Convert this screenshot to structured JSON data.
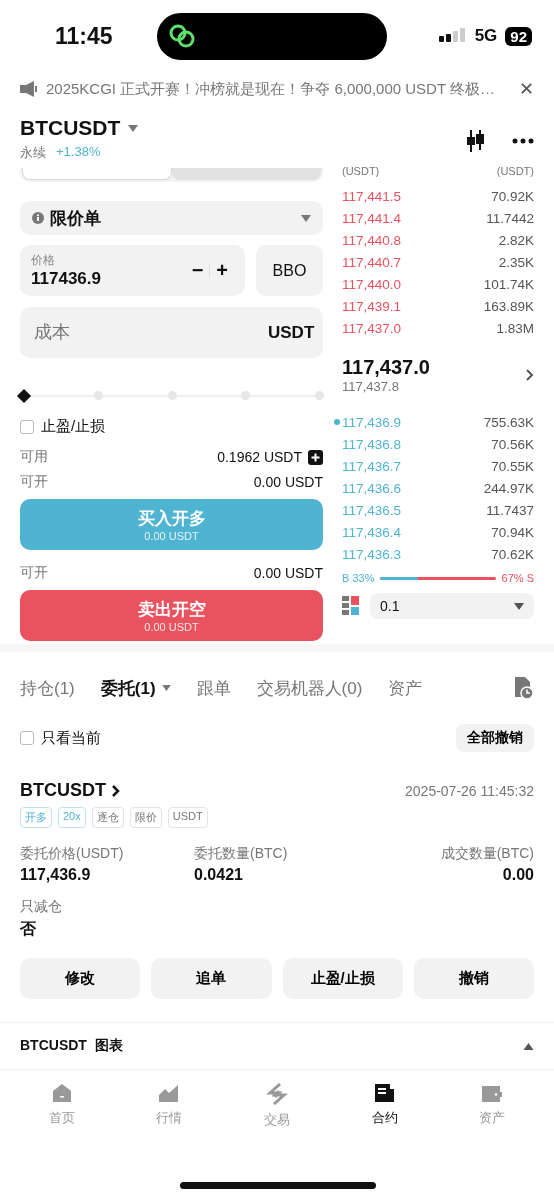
{
  "status_bar": {
    "time": "11:45",
    "network": "5G",
    "battery": "92"
  },
  "announcement": {
    "text": "2025KCGI 正式开赛！冲榜就是现在！争夺 6,000,000 USDT 终极…",
    "close": "✕"
  },
  "header": {
    "symbol": "BTCUSDT",
    "type": "永续",
    "change": "+1.38%"
  },
  "order_form": {
    "mode_tabs": [
      {
        "selected": true
      },
      {
        "selected": false
      }
    ],
    "order_type": "限价单",
    "price": {
      "label": "价格",
      "value": "117436.9",
      "minus": "−",
      "plus": "+"
    },
    "bbo": "BBO",
    "cost": {
      "placeholder": "成本",
      "unit": "USDT"
    },
    "slider": {
      "level": 0
    },
    "tpsl": {
      "label": "止盈/止损",
      "checked": false
    },
    "available": {
      "label": "可用",
      "value": "0.1962 USDT"
    },
    "buy": {
      "open_label": "可开",
      "open_value": "0.00 USDT",
      "title": "买入开多",
      "sub": "0.00 USDT"
    },
    "sell": {
      "open_label": "可开",
      "open_value": "0.00 USDT",
      "title": "卖出开空",
      "sub": "0.00 USDT"
    }
  },
  "order_book": {
    "columns": [
      "(USDT)",
      "(USDT)"
    ],
    "asks": [
      {
        "price": "117,441.5",
        "size": "70.92K"
      },
      {
        "price": "117,441.4",
        "size": "11.7442"
      },
      {
        "price": "117,440.8",
        "size": "2.82K"
      },
      {
        "price": "117,440.7",
        "size": "2.35K"
      },
      {
        "price": "117,440.0",
        "size": "101.74K"
      },
      {
        "price": "117,439.1",
        "size": "163.89K"
      },
      {
        "price": "117,437.0",
        "size": "1.83M"
      }
    ],
    "last_price": "117,437.0",
    "mark_price": "117,437.8",
    "bids": [
      {
        "price": "117,436.9",
        "size": "755.63K",
        "marked": true
      },
      {
        "price": "117,436.8",
        "size": "70.56K",
        "marked": false
      },
      {
        "price": "117,436.7",
        "size": "70.55K",
        "marked": false
      },
      {
        "price": "117,436.6",
        "size": "244.97K",
        "marked": false
      },
      {
        "price": "117,436.5",
        "size": "11.7437",
        "marked": false
      },
      {
        "price": "117,436.4",
        "size": "70.94K",
        "marked": false
      },
      {
        "price": "117,436.3",
        "size": "70.62K",
        "marked": false
      }
    ],
    "ratio": {
      "buy": "B 33%",
      "sell": "67% S",
      "level": 0.33
    },
    "precision": "0.1"
  },
  "tabs": [
    {
      "label": "持仓(1)",
      "selected": false,
      "dropdown": false
    },
    {
      "label": "委托(1)",
      "selected": true,
      "dropdown": true
    },
    {
      "label": "跟单",
      "selected": false,
      "dropdown": false
    },
    {
      "label": "交易机器人(0)",
      "selected": false,
      "dropdown": false
    },
    {
      "label": "资产",
      "selected": false,
      "dropdown": false
    }
  ],
  "filter": {
    "label": "只看当前",
    "checked": false
  },
  "cancel_all": "全部撤销",
  "order": {
    "symbol": "BTCUSDT",
    "time": "2025-07-26 11:45:32",
    "tags": [
      {
        "text": "开多",
        "kind": "accent"
      },
      {
        "text": "20x",
        "kind": "accent"
      },
      {
        "text": "逐仓",
        "kind": "plain"
      },
      {
        "text": "限价",
        "kind": "plain"
      },
      {
        "text": "USDT",
        "kind": "plain"
      }
    ],
    "fields": [
      {
        "label": "委托价格(USDT)",
        "value": "117,436.9"
      },
      {
        "label": "委托数量(BTC)",
        "value": "0.0421"
      },
      {
        "label": "成交数量(BTC)",
        "value": "0.00"
      }
    ],
    "reduce_only": {
      "label": "只减仓",
      "value": "否"
    },
    "actions": [
      "修改",
      "追单",
      "止盈/止损",
      "撤销"
    ]
  },
  "chart_section": {
    "title": "BTCUSDT  图表"
  },
  "bottom_nav": [
    {
      "label": "首页",
      "selected": false
    },
    {
      "label": "行情",
      "selected": false
    },
    {
      "label": "交易",
      "selected": false
    },
    {
      "label": "合约",
      "selected": true
    },
    {
      "label": "资产",
      "selected": false
    }
  ]
}
